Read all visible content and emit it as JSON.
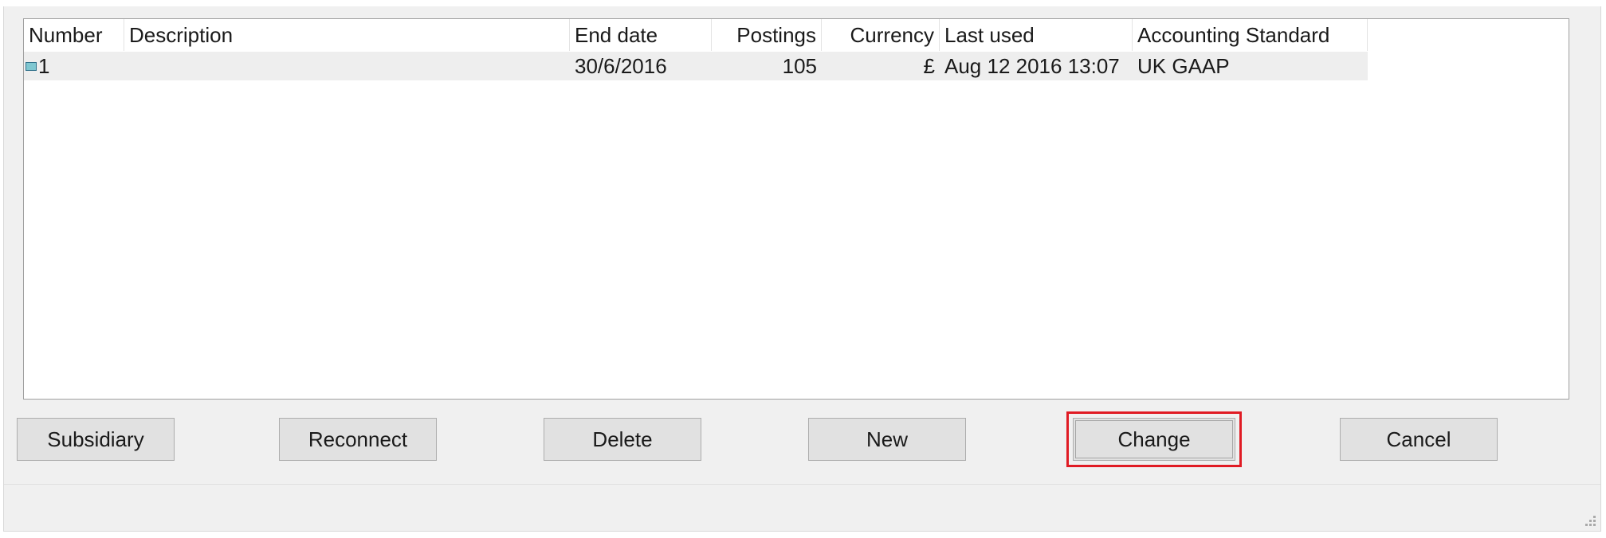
{
  "list": {
    "columns": [
      "Number",
      "Description",
      "End date",
      "Postings",
      "Currency",
      "Last used",
      "Accounting Standard"
    ],
    "rows": [
      {
        "number": "1",
        "description": "",
        "end_date": "30/6/2016",
        "postings": "105",
        "currency": "£",
        "last_used": "Aug 12 2016 13:07",
        "accounting_standard": "UK GAAP",
        "icon": "company-file-icon"
      }
    ]
  },
  "buttons": {
    "subsidiary": "Subsidiary",
    "reconnect": "Reconnect",
    "delete": "Delete",
    "new": "New",
    "change": "Change",
    "cancel": "Cancel"
  },
  "highlight_color": "#e01b24"
}
